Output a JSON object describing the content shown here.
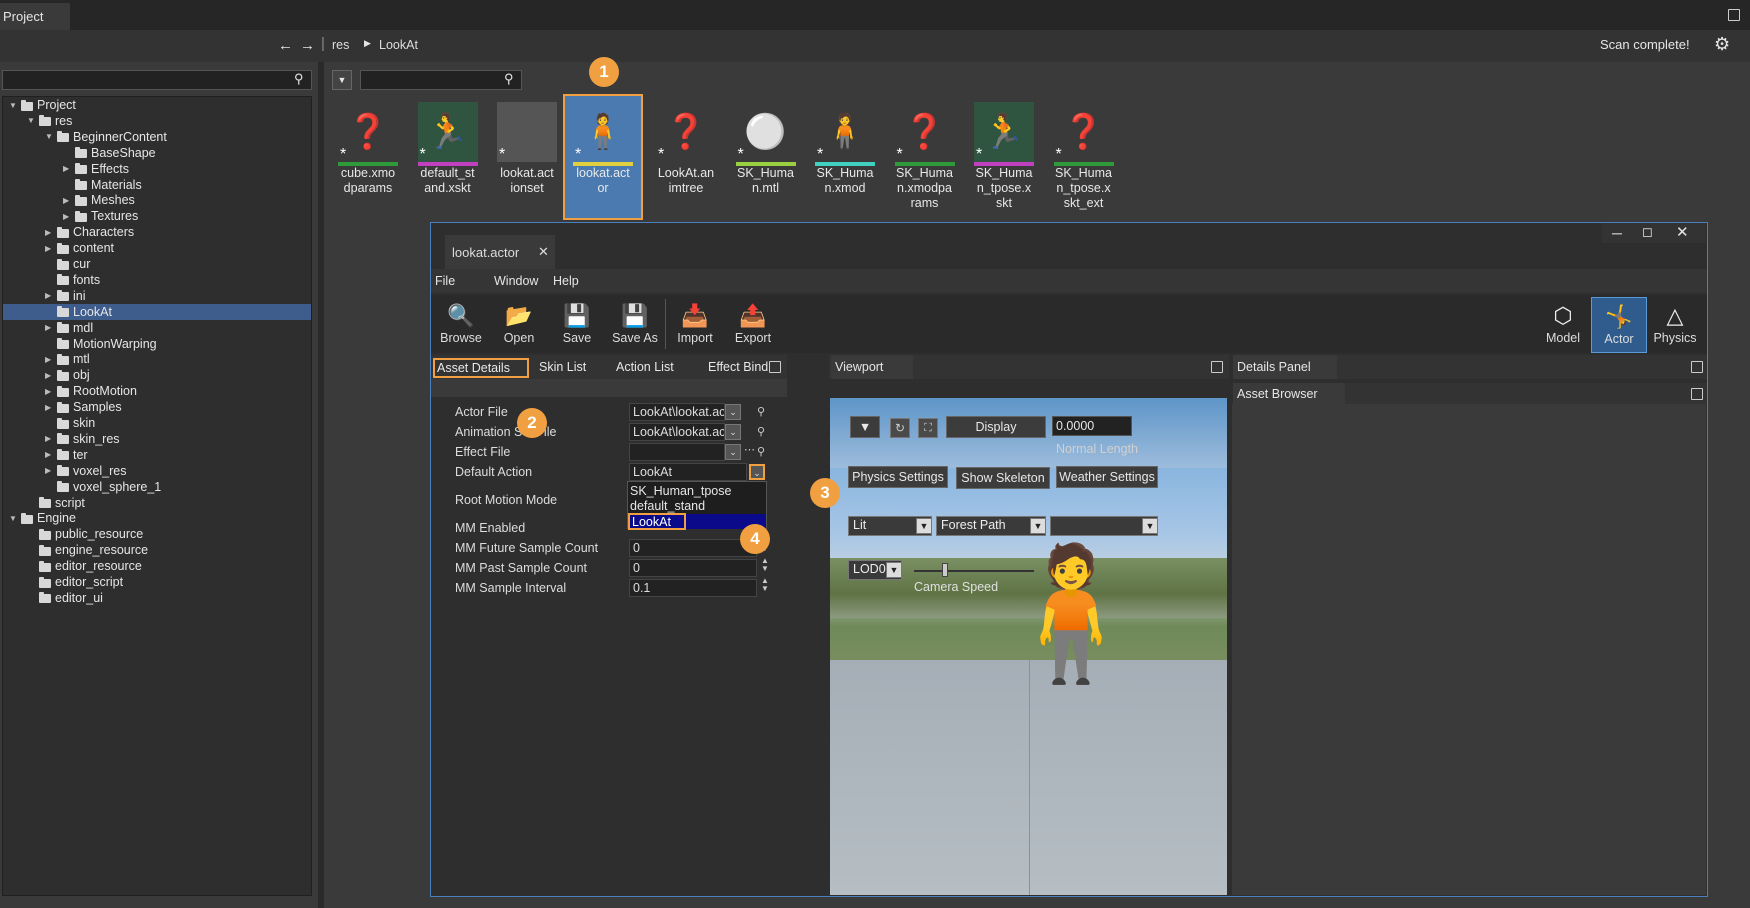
{
  "top": {
    "panel_title": "Project"
  },
  "crumbs": {
    "res": "res",
    "lookat": "LookAt",
    "status": "Scan complete!"
  },
  "tree": [
    {
      "label": "Project",
      "depth": 0,
      "open": true
    },
    {
      "label": "res",
      "depth": 1,
      "open": true
    },
    {
      "label": "BeginnerContent",
      "depth": 2,
      "open": true
    },
    {
      "label": "BaseShape",
      "depth": 3,
      "open": null
    },
    {
      "label": "Effects",
      "depth": 3,
      "open": false
    },
    {
      "label": "Materials",
      "depth": 3,
      "open": null
    },
    {
      "label": "Meshes",
      "depth": 3,
      "open": false
    },
    {
      "label": "Textures",
      "depth": 3,
      "open": false
    },
    {
      "label": "Characters",
      "depth": 2,
      "open": false
    },
    {
      "label": "content",
      "depth": 2,
      "open": false
    },
    {
      "label": "cur",
      "depth": 2,
      "open": null
    },
    {
      "label": "fonts",
      "depth": 2,
      "open": null
    },
    {
      "label": "ini",
      "depth": 2,
      "open": false
    },
    {
      "label": "LookAt",
      "depth": 2,
      "open": null,
      "selected": true
    },
    {
      "label": "mdl",
      "depth": 2,
      "open": false
    },
    {
      "label": "MotionWarping",
      "depth": 2,
      "open": null
    },
    {
      "label": "mtl",
      "depth": 2,
      "open": false
    },
    {
      "label": "obj",
      "depth": 2,
      "open": false
    },
    {
      "label": "RootMotion",
      "depth": 2,
      "open": false
    },
    {
      "label": "Samples",
      "depth": 2,
      "open": false
    },
    {
      "label": "skin",
      "depth": 2,
      "open": null
    },
    {
      "label": "skin_res",
      "depth": 2,
      "open": false
    },
    {
      "label": "ter",
      "depth": 2,
      "open": false
    },
    {
      "label": "voxel_res",
      "depth": 2,
      "open": false
    },
    {
      "label": "voxel_sphere_1",
      "depth": 2,
      "open": null
    },
    {
      "label": "script",
      "depth": 1,
      "open": null
    },
    {
      "label": "Engine",
      "depth": 0,
      "open": true
    },
    {
      "label": "public_resource",
      "depth": 1,
      "open": null
    },
    {
      "label": "engine_resource",
      "depth": 1,
      "open": null
    },
    {
      "label": "editor_resource",
      "depth": 1,
      "open": null
    },
    {
      "label": "editor_script",
      "depth": 1,
      "open": null
    },
    {
      "label": "editor_ui",
      "depth": 1,
      "open": null
    }
  ],
  "assets": [
    {
      "name": "cube.xmo\ndparams",
      "icon": "doc-question",
      "bar": "#2f9a3a"
    },
    {
      "name": "default_st\nand.xskt",
      "icon": "running-man",
      "bar": "#c040c0"
    },
    {
      "name": "lookat.act\nionset",
      "icon": "blank",
      "bar": ""
    },
    {
      "name": "lookat.act\nor",
      "icon": "standing-man",
      "bar": "#e0d040",
      "selected": true
    },
    {
      "name": "LookAt.an\nimtree",
      "icon": "doc-question",
      "bar": ""
    },
    {
      "name": "SK_Huma\nn.mtl",
      "icon": "sphere",
      "bar": "#9ad040"
    },
    {
      "name": "SK_Huma\nn.xmod",
      "icon": "mannequin",
      "bar": "#40d0c0"
    },
    {
      "name": "SK_Huma\nn.xmodpa\nrams",
      "icon": "doc-question",
      "bar": "#2f9a3a"
    },
    {
      "name": "SK_Huma\nn_tpose.x\nskt",
      "icon": "running-man",
      "bar": "#c040c0"
    },
    {
      "name": "SK_Huma\nn_tpose.x\nskt_ext",
      "icon": "doc-question",
      "bar": "#2f9a3a"
    }
  ],
  "badges": {
    "b1": "1",
    "b2": "2",
    "b3": "3",
    "b4": "4"
  },
  "editor": {
    "tab": "lookat.actor",
    "menu": {
      "file": "File",
      "window": "Window",
      "help": "Help"
    },
    "tools": {
      "browse": "Browse",
      "open": "Open",
      "save": "Save",
      "save_as": "Save As",
      "import": "Import",
      "export": "Export"
    },
    "modes": {
      "model": "Model",
      "actor": "Actor",
      "physics": "Physics"
    },
    "panel_tabs": {
      "asset_details": "Asset Details",
      "skin_list": "Skin List",
      "action_list": "Action List",
      "effect_bind": "Effect Bind",
      "viewport": "Viewport",
      "details_panel": "Details Panel",
      "asset_browser": "Asset Browser"
    },
    "props": {
      "actor_file": "Actor File",
      "actor_file_val": "LookAt\\lookat.ac",
      "anim_set_file": "Animation Set File",
      "anim_set_val": "LookAt\\lookat.ac",
      "effect_file": "Effect File",
      "effect_file_val": "",
      "default_action": "Default Action",
      "default_action_val": "LookAt",
      "root_motion": "Root Motion Mode",
      "mm_enabled": "MM Enabled",
      "mm_future": "MM Future Sample Count",
      "mm_future_val": "0",
      "mm_past": "MM Past Sample Count",
      "mm_past_val": "0",
      "mm_interval": "MM Sample Interval",
      "mm_interval_val": "0.1"
    },
    "dropdown_options": [
      "SK_Human_tpose",
      "default_stand",
      "LookAt"
    ],
    "viewport": {
      "display": "Display",
      "display_val": "0.0000",
      "normal_length": "Normal Length",
      "physics_settings": "Physics Settings",
      "show_skeleton": "Show Skeleton",
      "weather_settings": "Weather Settings",
      "lit": "Lit",
      "forest_path": "Forest Path",
      "third": "",
      "lod": "LOD0",
      "camera_speed": "Camera Speed"
    }
  }
}
